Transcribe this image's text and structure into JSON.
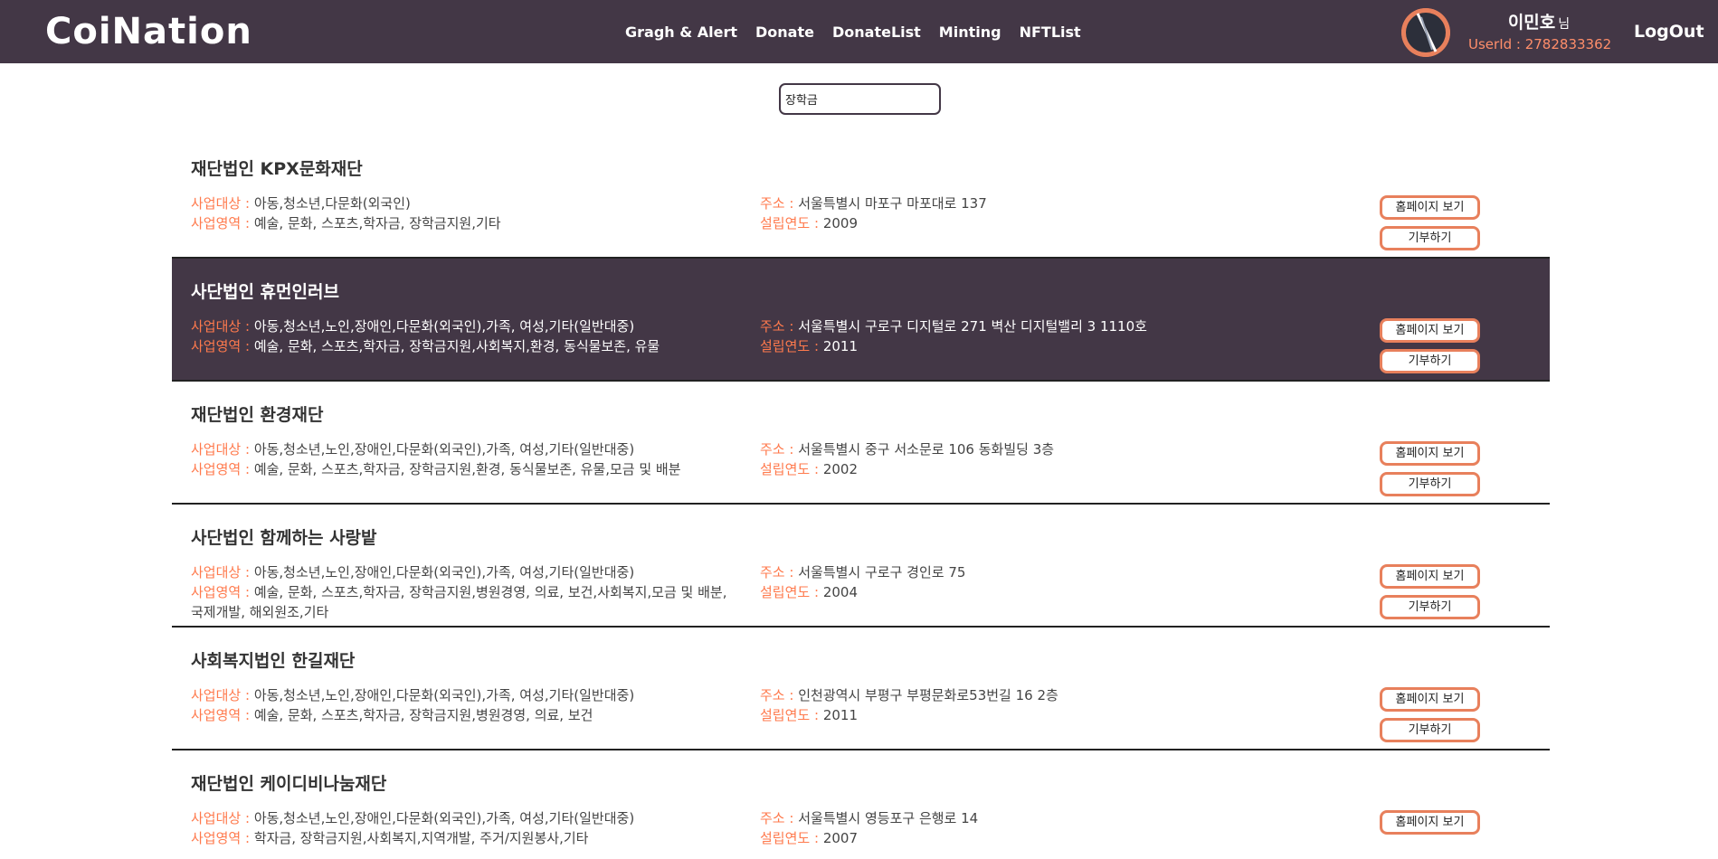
{
  "header": {
    "logo": "CoiNation",
    "nav": [
      "Gragh & Alert",
      "Donate",
      "DonateList",
      "Minting",
      "NFTList"
    ],
    "user_name": "이민호",
    "user_suffix": "님",
    "user_id": "UserId : 2782833362",
    "logout": "LogOut"
  },
  "search": {
    "value": "장학금"
  },
  "labels": {
    "target": "사업대상 :",
    "area": "사업영역 :",
    "address": "주소 :",
    "year": "설립연도 :",
    "home_button": "홈페이지 보기",
    "donate_button": "기부하기"
  },
  "orgs": [
    {
      "name": "재단법인 KPX문화재단",
      "target": "아동,청소년,다문화(외국인)",
      "area": "예술, 문화, 스포츠,학자금, 장학금지원,기타",
      "address": "서울특별시 마포구 마포대로 137",
      "year": "2009"
    },
    {
      "name": "사단법인 휴먼인러브",
      "target": "아동,청소년,노인,장애인,다문화(외국인),가족, 여성,기타(일반대중)",
      "area": "예술, 문화, 스포츠,학자금, 장학금지원,사회복지,환경, 동식물보존, 유물",
      "address": "서울특별시 구로구 디지털로 271 벽산 디지털밸리 3 1110호",
      "year": "2011"
    },
    {
      "name": "재단법인 환경재단",
      "target": "아동,청소년,노인,장애인,다문화(외국인),가족, 여성,기타(일반대중)",
      "area": "예술, 문화, 스포츠,학자금, 장학금지원,환경, 동식물보존, 유물,모금 및 배분",
      "address": "서울특별시 중구 서소문로 106 동화빌딩 3층",
      "year": "2002"
    },
    {
      "name": "사단법인 함께하는 사랑밭",
      "target": "아동,청소년,노인,장애인,다문화(외국인),가족, 여성,기타(일반대중)",
      "area": "예술, 문화, 스포츠,학자금, 장학금지원,병원경영, 의료, 보건,사회복지,모금 및 배분,국제개발, 해외원조,기타",
      "address": "서울특별시 구로구 경인로 75",
      "year": "2004"
    },
    {
      "name": "사회복지법인 한길재단",
      "target": "아동,청소년,노인,장애인,다문화(외국인),가족, 여성,기타(일반대중)",
      "area": "예술, 문화, 스포츠,학자금, 장학금지원,병원경영, 의료, 보건",
      "address": "인천광역시 부평구 부평문화로53번길 16 2층",
      "year": "2011"
    },
    {
      "name": "재단법인 케이디비나눔재단",
      "target": "아동,청소년,노인,장애인,다문화(외국인),가족, 여성,기타(일반대중)",
      "area": "학자금, 장학금지원,사회복지,지역개발, 주거/지원봉사,기타",
      "address": "서울특별시 영등포구 은행로 14",
      "year": "2007"
    }
  ]
}
